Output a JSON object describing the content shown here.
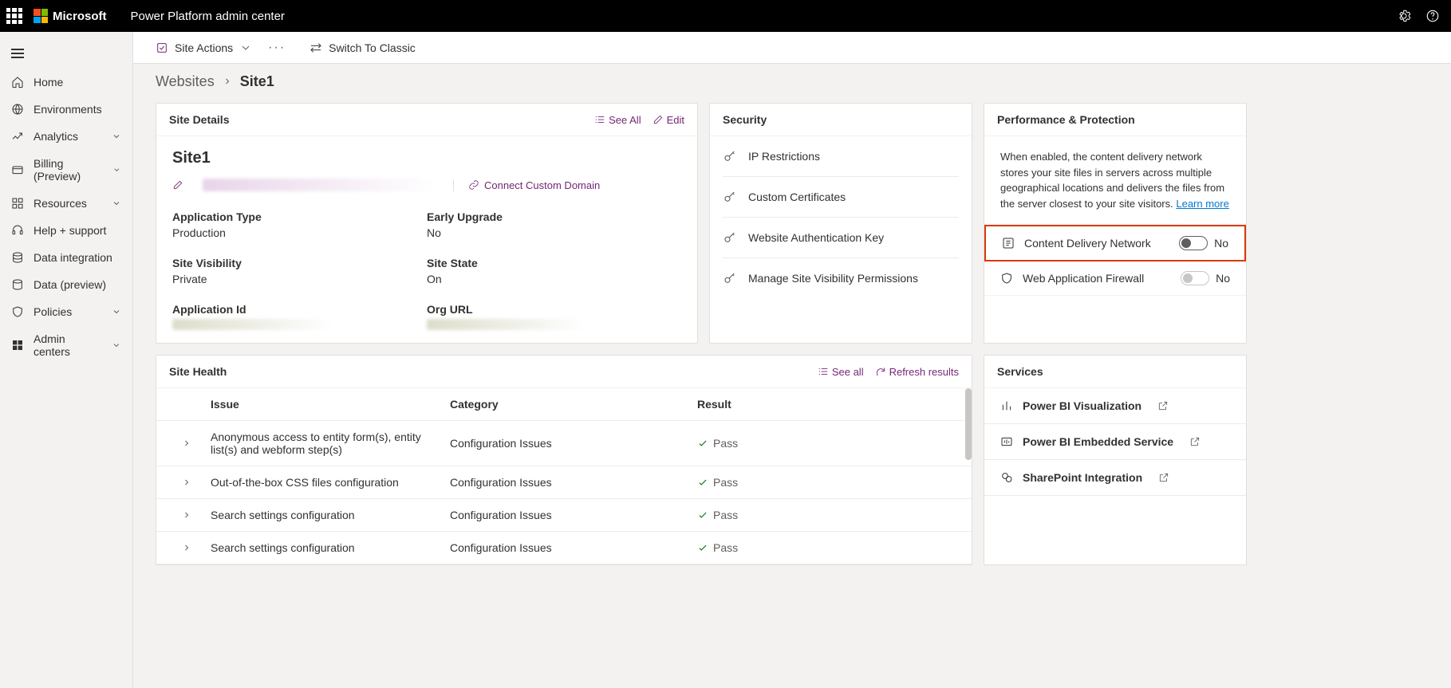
{
  "brand": {
    "company": "Microsoft",
    "app": "Power Platform admin center"
  },
  "sidebar": {
    "items": [
      {
        "label": "Home"
      },
      {
        "label": "Environments"
      },
      {
        "label": "Analytics"
      },
      {
        "label": "Billing (Preview)"
      },
      {
        "label": "Resources"
      },
      {
        "label": "Help + support"
      },
      {
        "label": "Data integration"
      },
      {
        "label": "Data (preview)"
      },
      {
        "label": "Policies"
      },
      {
        "label": "Admin centers"
      }
    ]
  },
  "cmdbar": {
    "siteActions": "Site Actions",
    "switch": "Switch To Classic"
  },
  "breadcrumb": {
    "parent": "Websites",
    "current": "Site1"
  },
  "siteDetails": {
    "title": "Site Details",
    "seeAll": "See All",
    "edit": "Edit",
    "siteName": "Site1",
    "connect": "Connect Custom Domain",
    "fields": {
      "appTypeLabel": "Application Type",
      "appTypeVal": "Production",
      "earlyLabel": "Early Upgrade",
      "earlyVal": "No",
      "visLabel": "Site Visibility",
      "visVal": "Private",
      "stateLabel": "Site State",
      "stateVal": "On",
      "appIdLabel": "Application Id",
      "orgUrlLabel": "Org URL"
    }
  },
  "security": {
    "title": "Security",
    "items": [
      "IP Restrictions",
      "Custom Certificates",
      "Website Authentication Key",
      "Manage Site Visibility Permissions"
    ]
  },
  "perf": {
    "title": "Performance & Protection",
    "desc": "When enabled, the content delivery network stores your site files in servers across multiple geographical locations and delivers the files from the server closest to your site visitors. ",
    "learn": "Learn more",
    "cdn": "Content Delivery Network",
    "cdnVal": "No",
    "waf": "Web Application Firewall",
    "wafVal": "No"
  },
  "health": {
    "title": "Site Health",
    "seeAll": "See all",
    "refresh": "Refresh results",
    "cols": {
      "issue": "Issue",
      "category": "Category",
      "result": "Result"
    },
    "rows": [
      {
        "issue": "Anonymous access to entity form(s), entity list(s) and webform step(s)",
        "cat": "Configuration Issues",
        "res": "Pass"
      },
      {
        "issue": "Out-of-the-box CSS files configuration",
        "cat": "Configuration Issues",
        "res": "Pass"
      },
      {
        "issue": "Search settings configuration",
        "cat": "Configuration Issues",
        "res": "Pass"
      },
      {
        "issue": "Search settings configuration",
        "cat": "Configuration Issues",
        "res": "Pass"
      }
    ]
  },
  "services": {
    "title": "Services",
    "items": [
      "Power BI Visualization",
      "Power BI Embedded Service",
      "SharePoint Integration"
    ]
  }
}
